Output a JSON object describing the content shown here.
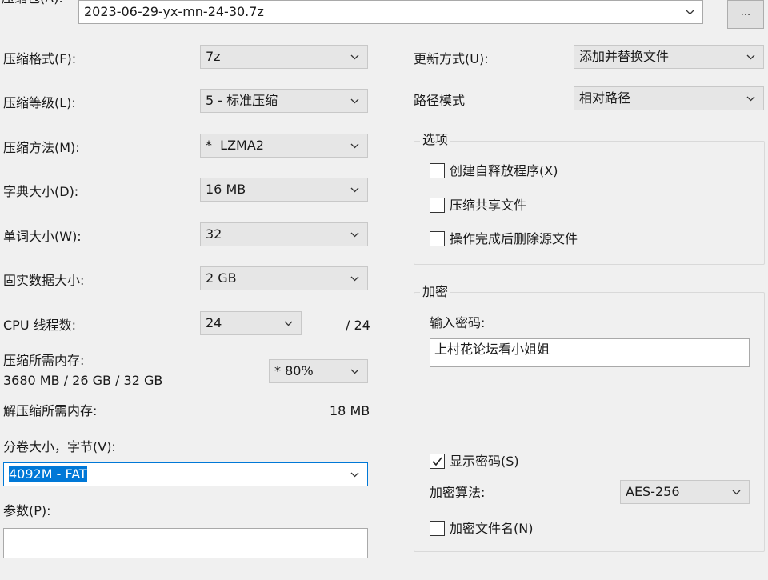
{
  "archive": {
    "label": "压缩包(A):",
    "path": "2023-06-29-yx-mn-24-30.7z",
    "browse_label": "..."
  },
  "left": {
    "format": {
      "label": "压缩格式(F):",
      "value": "7z"
    },
    "level": {
      "label": "压缩等级(L):",
      "value": "5 - 标准压缩"
    },
    "method": {
      "label": "压缩方法(M):",
      "value": "*  LZMA2"
    },
    "dictionary": {
      "label": "字典大小(D):",
      "value": "16 MB"
    },
    "word": {
      "label": "单词大小(W):",
      "value": "32"
    },
    "solid": {
      "label": "固实数据大小:",
      "value": "2 GB"
    },
    "threads": {
      "label": "CPU 线程数:",
      "value": "24",
      "max": "/ 24"
    },
    "memory": {
      "label": "压缩所需内存:",
      "detail": "3680 MB / 26 GB / 32 GB",
      "value": "* 80%"
    },
    "decompress": {
      "label": "解压缩所需内存:",
      "value": "18 MB"
    },
    "volume": {
      "label": "分卷大小，字节(V):",
      "value": "4092M - FAT"
    },
    "params": {
      "label": "参数(P):",
      "value": ""
    }
  },
  "right": {
    "update": {
      "label": "更新方式(U):",
      "value": "添加并替换文件"
    },
    "path_mode": {
      "label": "路径模式",
      "value": "相对路径"
    },
    "options": {
      "title": "选项",
      "items": [
        {
          "label": "创建自释放程序(X)",
          "checked": false
        },
        {
          "label": "压缩共享文件",
          "checked": false
        },
        {
          "label": "操作完成后删除源文件",
          "checked": false
        }
      ]
    },
    "encryption": {
      "title": "加密",
      "password_label": "输入密码:",
      "password_value": "上村花论坛看小姐姐",
      "show_password": {
        "label": "显示密码(S)",
        "checked": true
      },
      "method_label": "加密算法:",
      "method_value": "AES-256",
      "encrypt_names": {
        "label": "加密文件名(N)",
        "checked": false
      }
    }
  }
}
